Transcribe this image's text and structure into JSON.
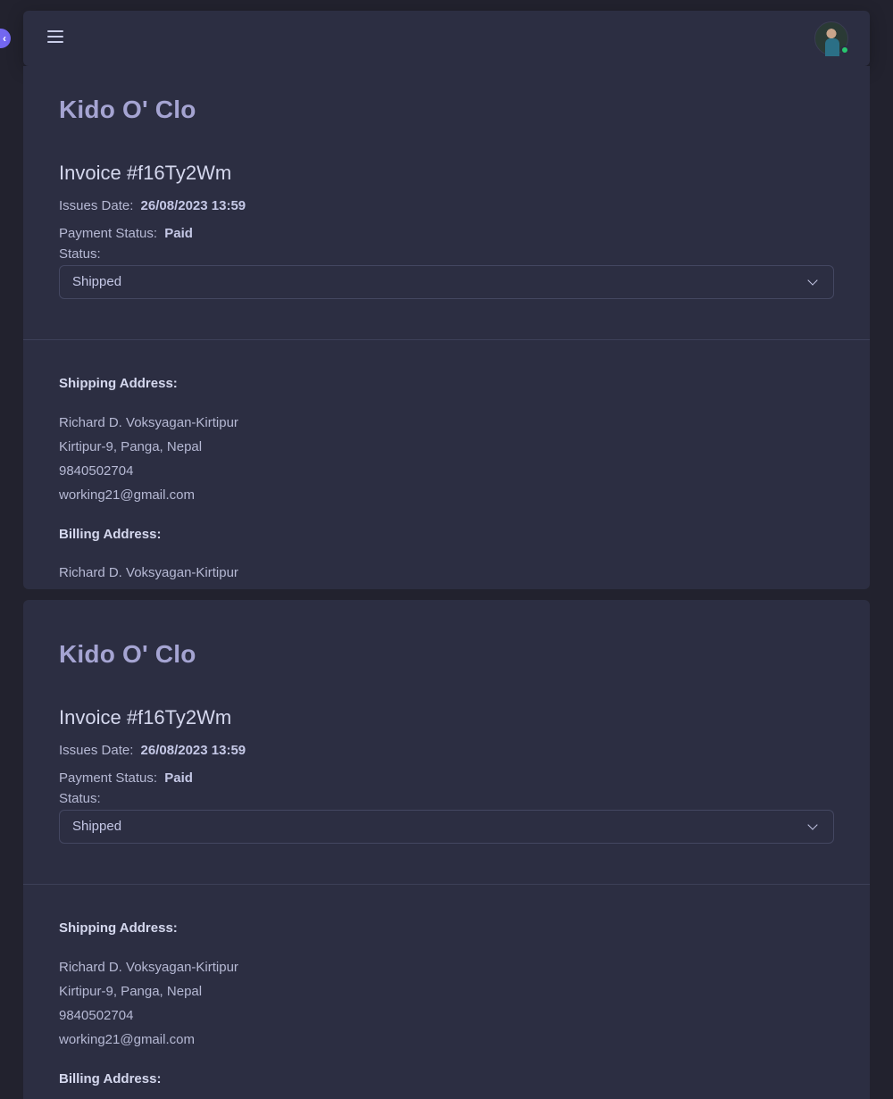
{
  "navbar": {
    "menu_icon": "hamburger-icon",
    "avatar_icon": "user-avatar",
    "status_color": "#28c76f"
  },
  "theme": {
    "accent": "#7367f0",
    "background": "#22222e",
    "card": "#2c2e42"
  },
  "invoices": [
    {
      "brand": "Kido O' Clo",
      "title": "Invoice #f16Ty2Wm",
      "issues_label": "Issues Date:",
      "issues_value": "26/08/2023 13:59",
      "payment_label": "Payment Status:",
      "payment_value": "Paid",
      "status_label": "Status:",
      "status_value": "Shipped",
      "shipping_title": "Shipping Address:",
      "shipping": {
        "name": "Richard D. Voksyagan-Kirtipur",
        "address": "Kirtipur-9, Panga, Nepal",
        "phone": "9840502704",
        "email": "working21@gmail.com"
      },
      "billing_title": "Billing Address:",
      "billing": {
        "name": "Richard D. Voksyagan-Kirtipur"
      }
    },
    {
      "brand": "Kido O' Clo",
      "title": "Invoice #f16Ty2Wm",
      "issues_label": "Issues Date:",
      "issues_value": "26/08/2023 13:59",
      "payment_label": "Payment Status:",
      "payment_value": "Paid",
      "status_label": "Status:",
      "status_value": "Shipped",
      "shipping_title": "Shipping Address:",
      "shipping": {
        "name": "Richard D. Voksyagan-Kirtipur",
        "address": "Kirtipur-9, Panga, Nepal",
        "phone": "9840502704",
        "email": "working21@gmail.com"
      },
      "billing_title": "Billing Address:"
    }
  ]
}
